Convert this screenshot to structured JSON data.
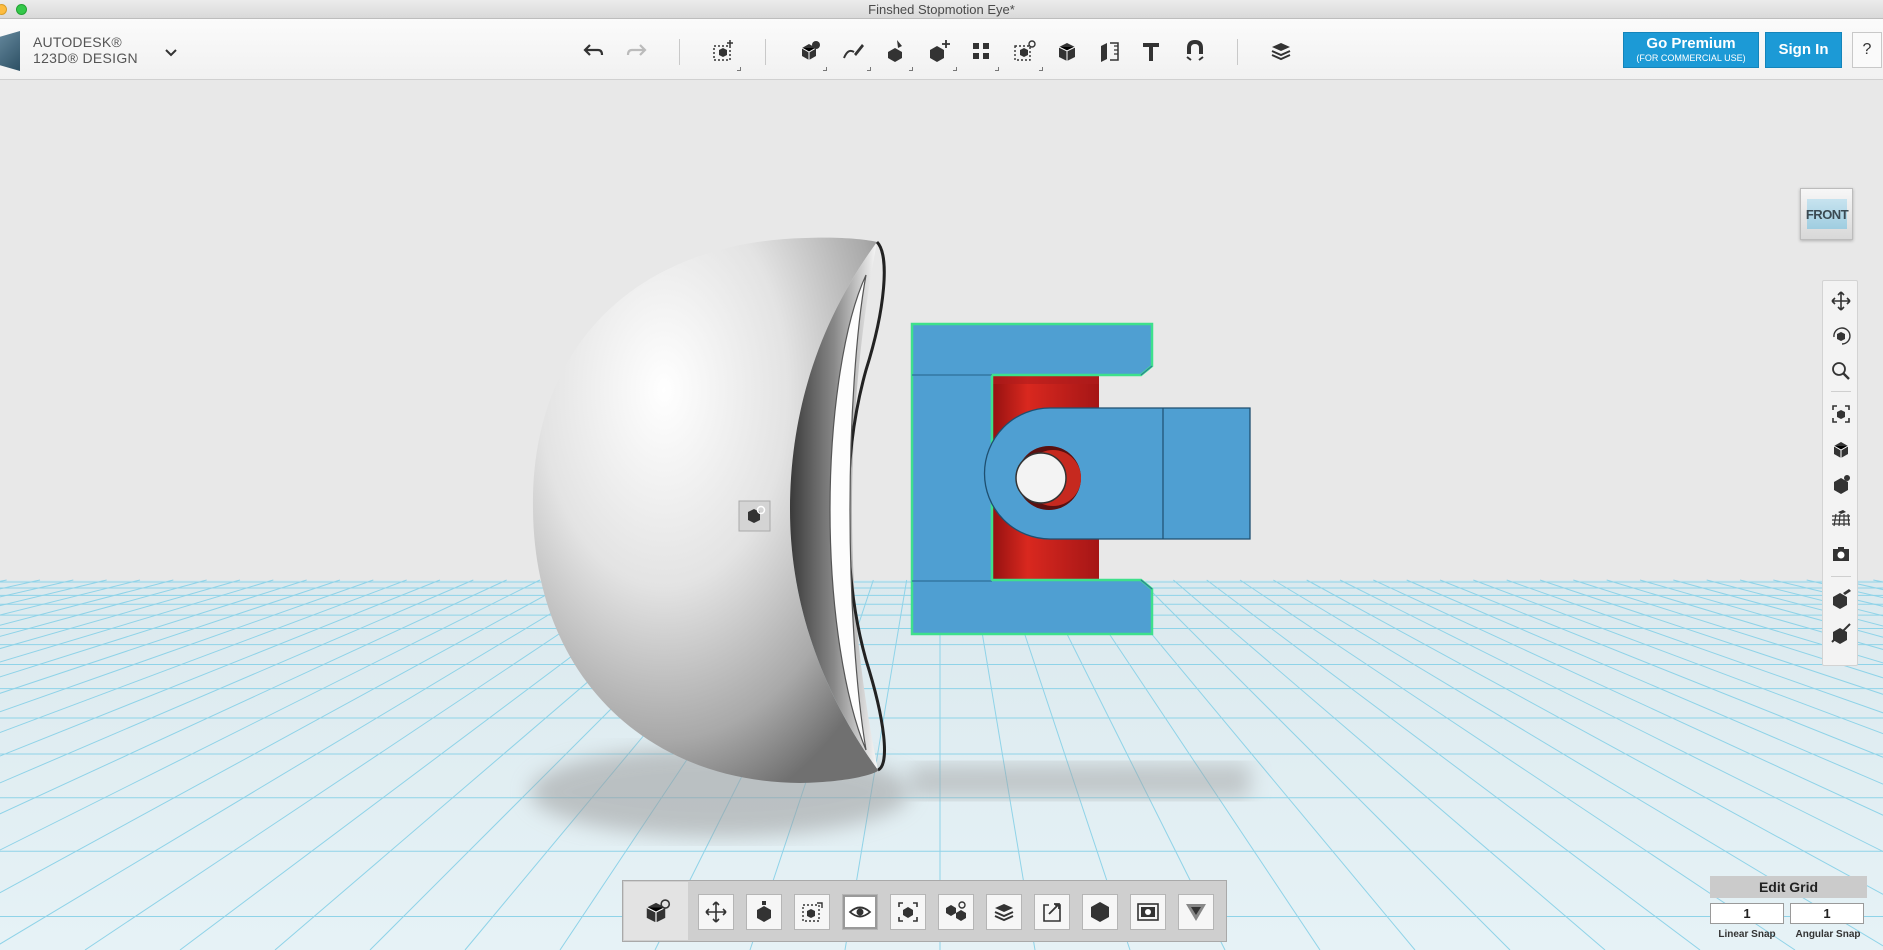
{
  "window": {
    "title": "Finshed Stopmotion Eye*"
  },
  "brand": {
    "line1": "AUTODESK®",
    "line2": "123D® DESIGN",
    "menu_icon": "chevron-down"
  },
  "toolbar": {
    "undo_icon": "undo-arrow",
    "redo_icon": "redo-arrow",
    "tools": [
      "transform",
      "primitives",
      "sketch",
      "construct",
      "modify",
      "pattern",
      "grouping",
      "combine",
      "measure",
      "text",
      "snap",
      "materials"
    ]
  },
  "premium": {
    "main": "Go Premium",
    "sub": "(FOR COMMERCIAL USE)"
  },
  "signin": {
    "label": "Sign In"
  },
  "help": {
    "label": "?"
  },
  "viewcube": {
    "face": "FRONT"
  },
  "colors": {
    "accent": "#1c9ad6",
    "part_blue": "#4f9fd2",
    "part_red": "#c61d1d",
    "selection": "#3ee08c",
    "grid": "#7fcde6"
  },
  "navbar": {
    "items": [
      "pan",
      "orbit",
      "zoom",
      "fit",
      "perspective",
      "visual-style",
      "grid-toggle",
      "camera",
      "material-toggle",
      "hide-toggle"
    ]
  },
  "bottombar": {
    "items": [
      "view-mode",
      "move",
      "smart-scale",
      "bounding-box",
      "show-hide",
      "fit-select",
      "group",
      "combine",
      "export",
      "material",
      "snapshot",
      "filter"
    ],
    "active": "show-hide"
  },
  "grid": {
    "title": "Edit Grid",
    "linear_value": "1",
    "angular_value": "1",
    "linear_label": "Linear Snap",
    "angular_label": "Angular Snap"
  }
}
